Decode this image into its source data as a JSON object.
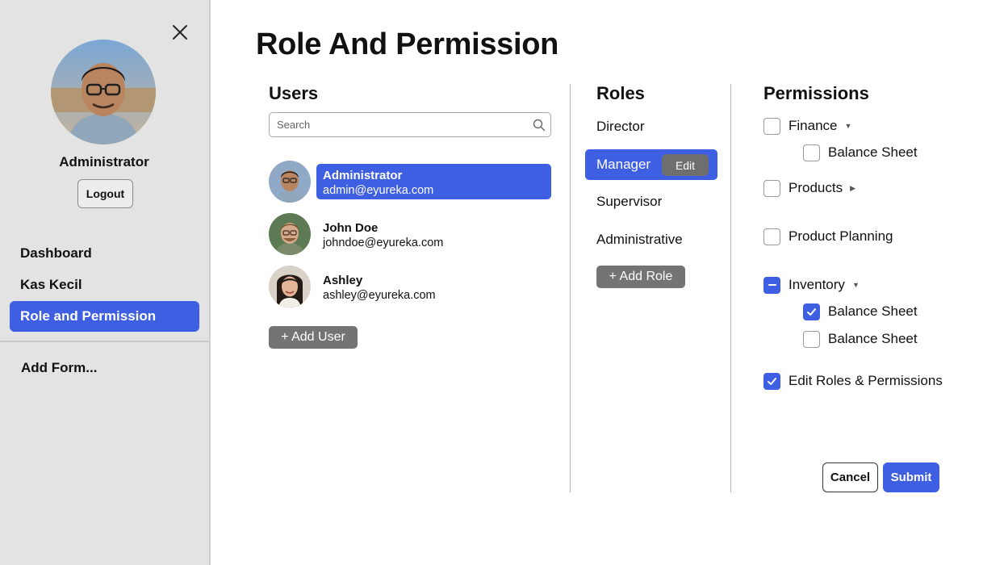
{
  "sidebar": {
    "user_name": "Administrator",
    "logout_label": "Logout",
    "nav": [
      {
        "label": "Dashboard"
      },
      {
        "label": "Kas Kecil"
      },
      {
        "label": "Role and Permission"
      }
    ],
    "active_index": 2,
    "add_form_label": "Add Form..."
  },
  "page": {
    "title": "Role And Permission"
  },
  "users": {
    "title": "Users",
    "search_placeholder": "Search",
    "items": [
      {
        "name": "Administrator",
        "email": "admin@eyureka.com"
      },
      {
        "name": "John Doe",
        "email": "johndoe@eyureka.com"
      },
      {
        "name": "Ashley",
        "email": "ashley@eyureka.com"
      }
    ],
    "selected_index": 0,
    "add_label": "+ Add User"
  },
  "roles": {
    "title": "Roles",
    "items": [
      {
        "label": "Director"
      },
      {
        "label": "Manager"
      },
      {
        "label": "Supervisor"
      },
      {
        "label": "Administrative"
      }
    ],
    "selected_index": 1,
    "edit_label": "Edit",
    "add_label": "+ Add Role"
  },
  "permissions": {
    "title": "Permissions",
    "items": [
      {
        "label": "Finance",
        "state": "unchecked",
        "caret": "down"
      },
      {
        "label": "Balance Sheet",
        "state": "unchecked"
      },
      {
        "label": "Products",
        "state": "unchecked",
        "caret": "right"
      },
      {
        "label": "Product Planning",
        "state": "unchecked"
      },
      {
        "label": "Inventory",
        "state": "indeterminate",
        "caret": "down"
      },
      {
        "label": "Balance Sheet",
        "state": "checked"
      },
      {
        "label": "Balance Sheet",
        "state": "unchecked"
      },
      {
        "label": "Edit Roles & Permissions",
        "state": "checked"
      }
    ]
  },
  "actions": {
    "cancel_label": "Cancel",
    "submit_label": "Submit"
  },
  "colors": {
    "accent": "#3f5fe3",
    "sidebar_bg": "#e3e3e3",
    "gray_button": "#747474"
  }
}
